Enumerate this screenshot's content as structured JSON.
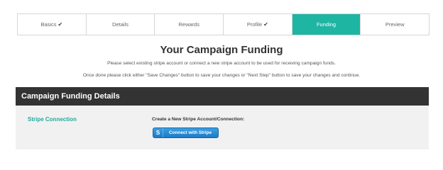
{
  "wizard": {
    "steps": [
      {
        "label": "Basics",
        "check": "✔"
      },
      {
        "label": "Details",
        "check": ""
      },
      {
        "label": "Rewards",
        "check": ""
      },
      {
        "label": "Profile",
        "check": "✔"
      },
      {
        "label": "Funding",
        "check": ""
      },
      {
        "label": "Preview",
        "check": ""
      }
    ],
    "active_color": "#1fb5a3"
  },
  "page": {
    "title": "Your Campaign Funding",
    "desc1": "Please select existing stripe account or connect a new stripe account to be used for receiving campaign funds.",
    "desc2": "Once done please click either \"Save Changes\" button to save your changes or \"Next Step\" button to save your changes and continue."
  },
  "panel": {
    "heading": "Campaign Funding Details",
    "stripe_label": "Stripe Connection",
    "create_label": "Create a New Stripe Account/Connection:",
    "button_icon": "S",
    "button_label": "Connect with Stripe"
  }
}
